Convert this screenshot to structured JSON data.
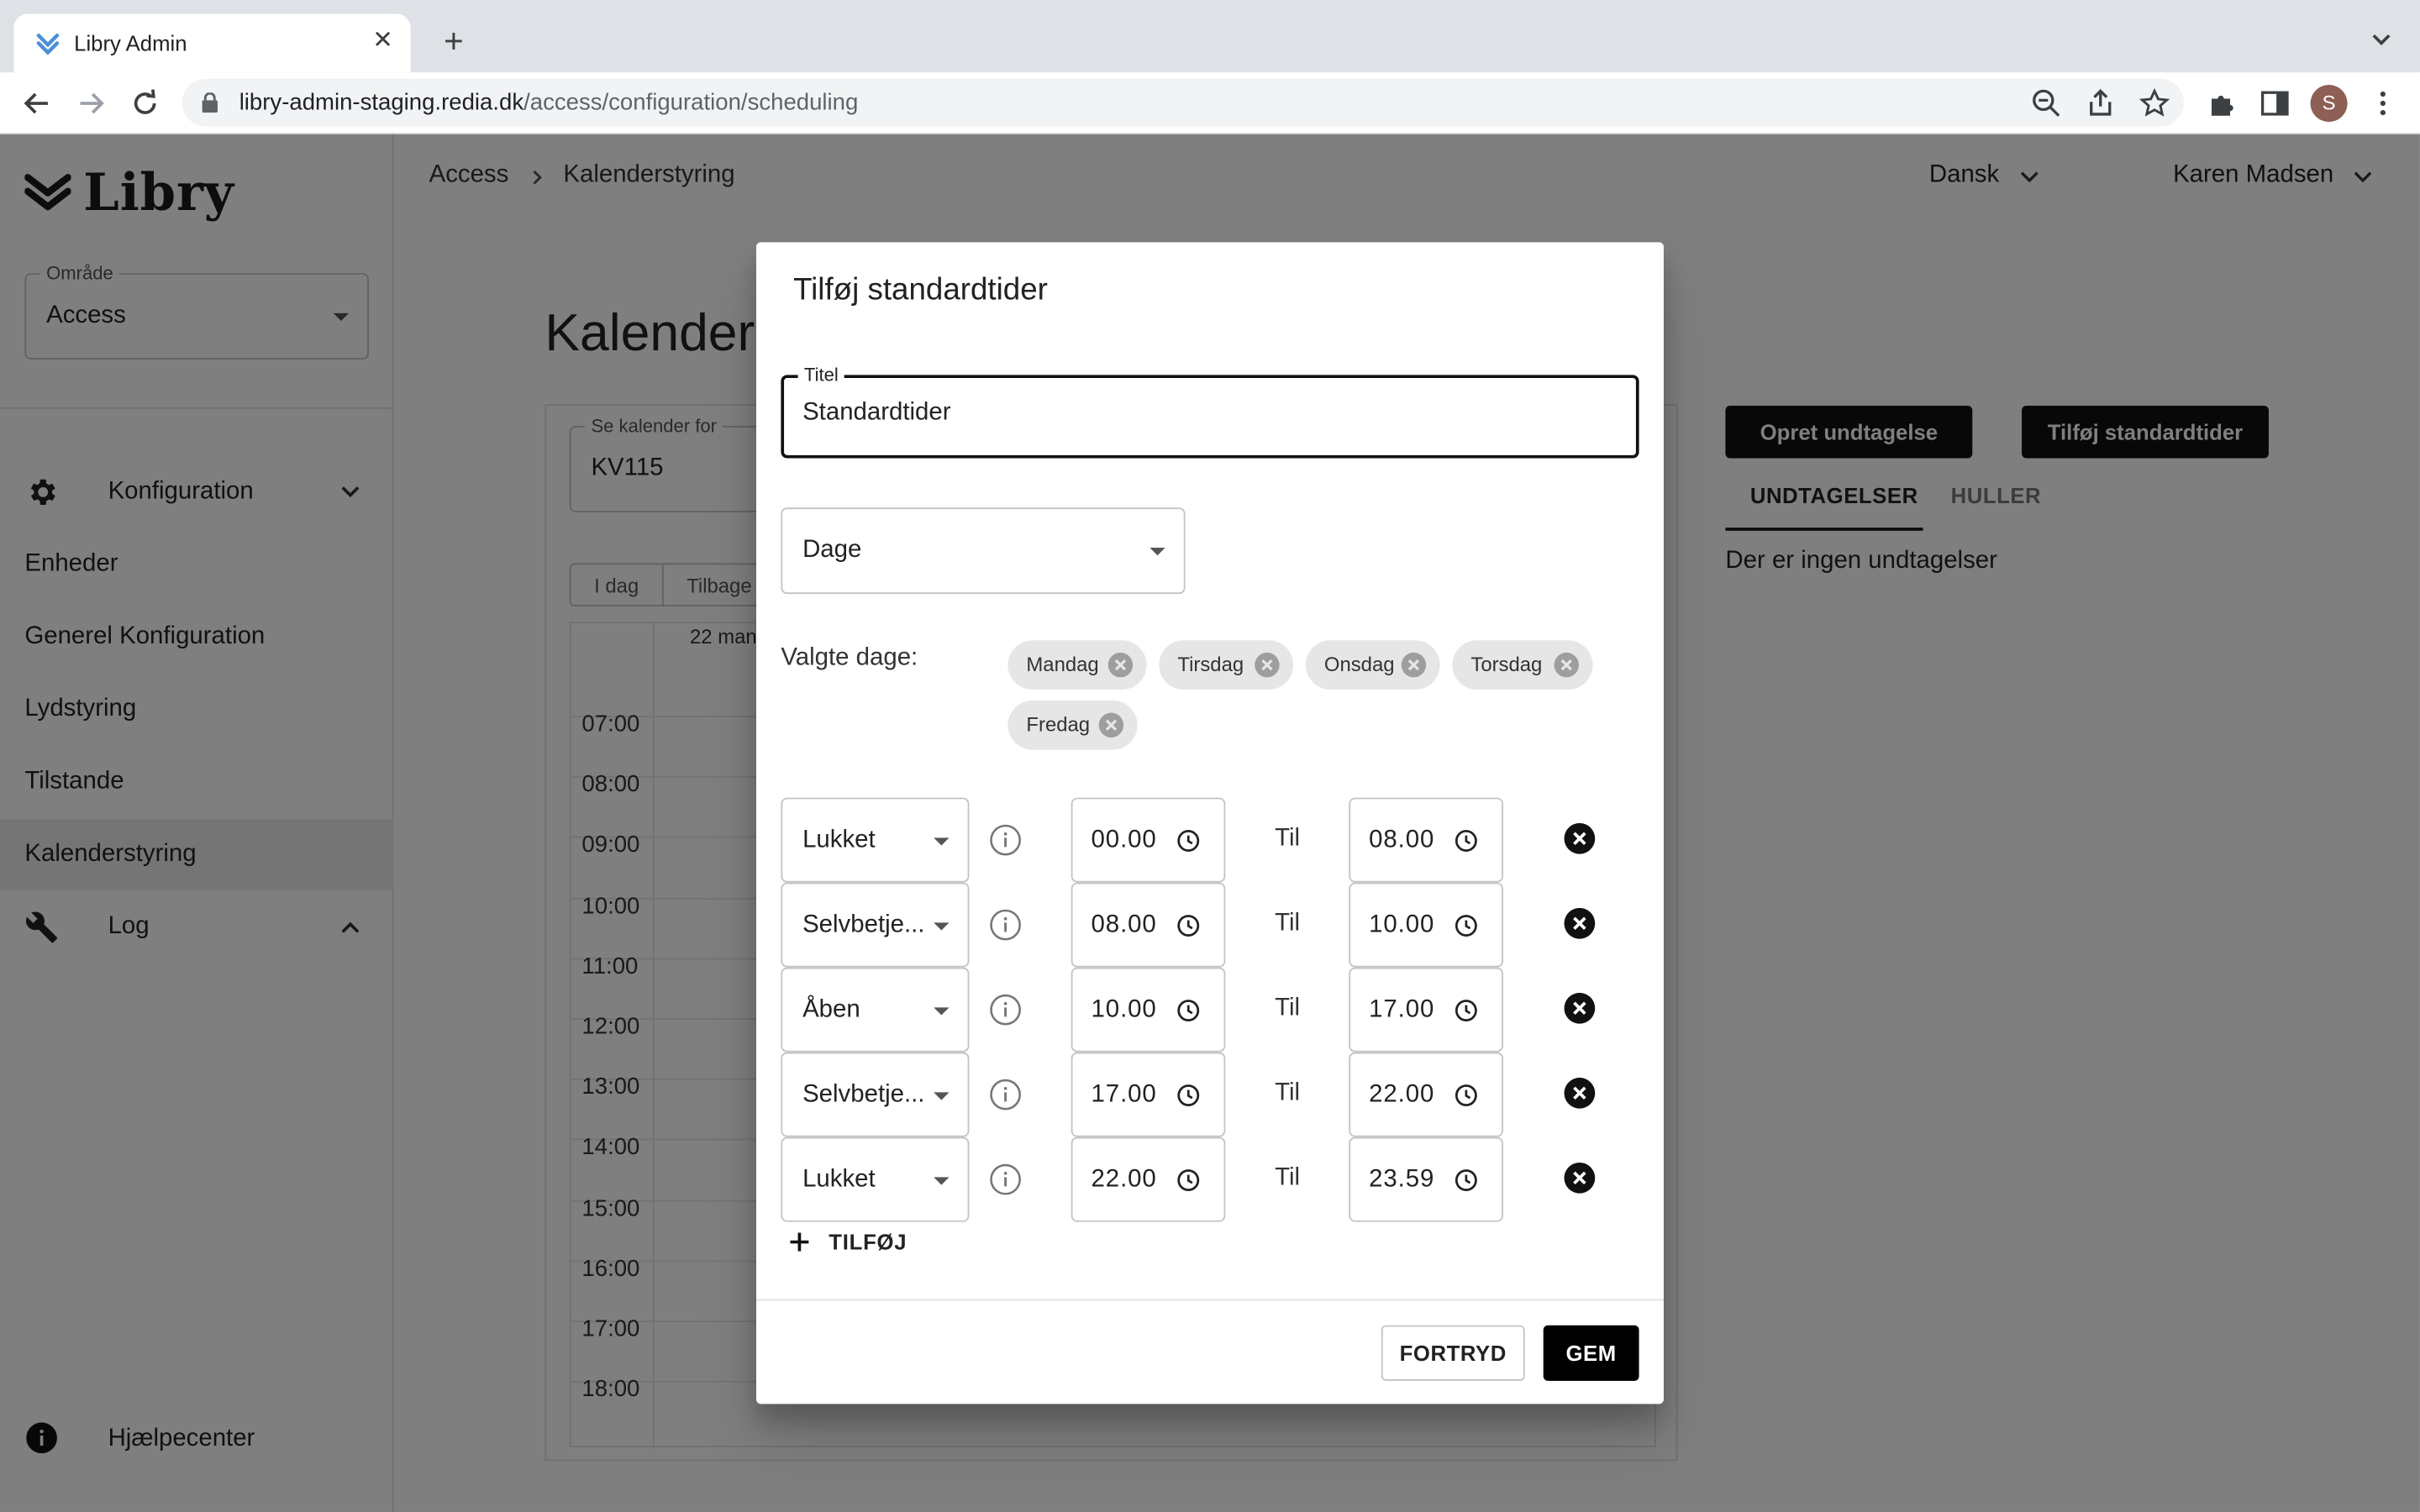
{
  "browser": {
    "tab_title": "Libry Admin",
    "url_host": "libry-admin-staging.redia.dk",
    "url_path": "/access/configuration/scheduling",
    "profile_initial": "S"
  },
  "sidebar": {
    "logo_text": "Libry",
    "area_label": "Område",
    "area_value": "Access",
    "config_group": "Konfiguration",
    "items": [
      {
        "label": "Enheder"
      },
      {
        "label": "Generel Konfiguration"
      },
      {
        "label": "Lydstyring"
      },
      {
        "label": "Tilstande"
      },
      {
        "label": "Kalenderstyring"
      }
    ],
    "log_group": "Log",
    "help": "Hjælpecenter"
  },
  "topbar": {
    "breadcrumb_root": "Access",
    "breadcrumb_current": "Kalenderstyring",
    "language": "Dansk",
    "user": "Karen Madsen"
  },
  "page": {
    "title": "Kalenderstyring",
    "calendar_for_label": "Se kalender for",
    "calendar_for_value": "KV115",
    "today_btn": "I dag",
    "back_btn": "Tilbage",
    "date_label": "22 man",
    "hours": [
      "07:00",
      "08:00",
      "09:00",
      "10:00",
      "11:00",
      "12:00",
      "13:00",
      "14:00",
      "15:00",
      "16:00",
      "17:00",
      "18:00"
    ],
    "create_exception_btn": "Opret undtagelse",
    "add_standard_btn": "Tilføj standardtider",
    "tab_exceptions": "UNDTAGELSER",
    "tab_gaps": "HULLER",
    "no_exceptions": "Der er ingen undtagelser"
  },
  "dialog": {
    "title": "Tilføj standardtider",
    "title_field_label": "Titel",
    "title_field_value": "Standardtider",
    "days_select": "Dage",
    "chosen_days_label": "Valgte dage:",
    "chips": [
      "Mandag",
      "Tirsdag",
      "Onsdag",
      "Torsdag",
      "Fredag"
    ],
    "to_label": "Til",
    "rows": [
      {
        "state": "Lukket",
        "from": "00.00",
        "to": "08.00"
      },
      {
        "state": "Selvbetje...",
        "from": "08.00",
        "to": "10.00"
      },
      {
        "state": "Åben",
        "from": "10.00",
        "to": "17.00"
      },
      {
        "state": "Selvbetje...",
        "from": "17.00",
        "to": "22.00"
      },
      {
        "state": "Lukket",
        "from": "22.00",
        "to": "23.59"
      }
    ],
    "add_label": "TILFØJ",
    "cancel_label": "FORTRYD",
    "save_label": "GEM"
  }
}
